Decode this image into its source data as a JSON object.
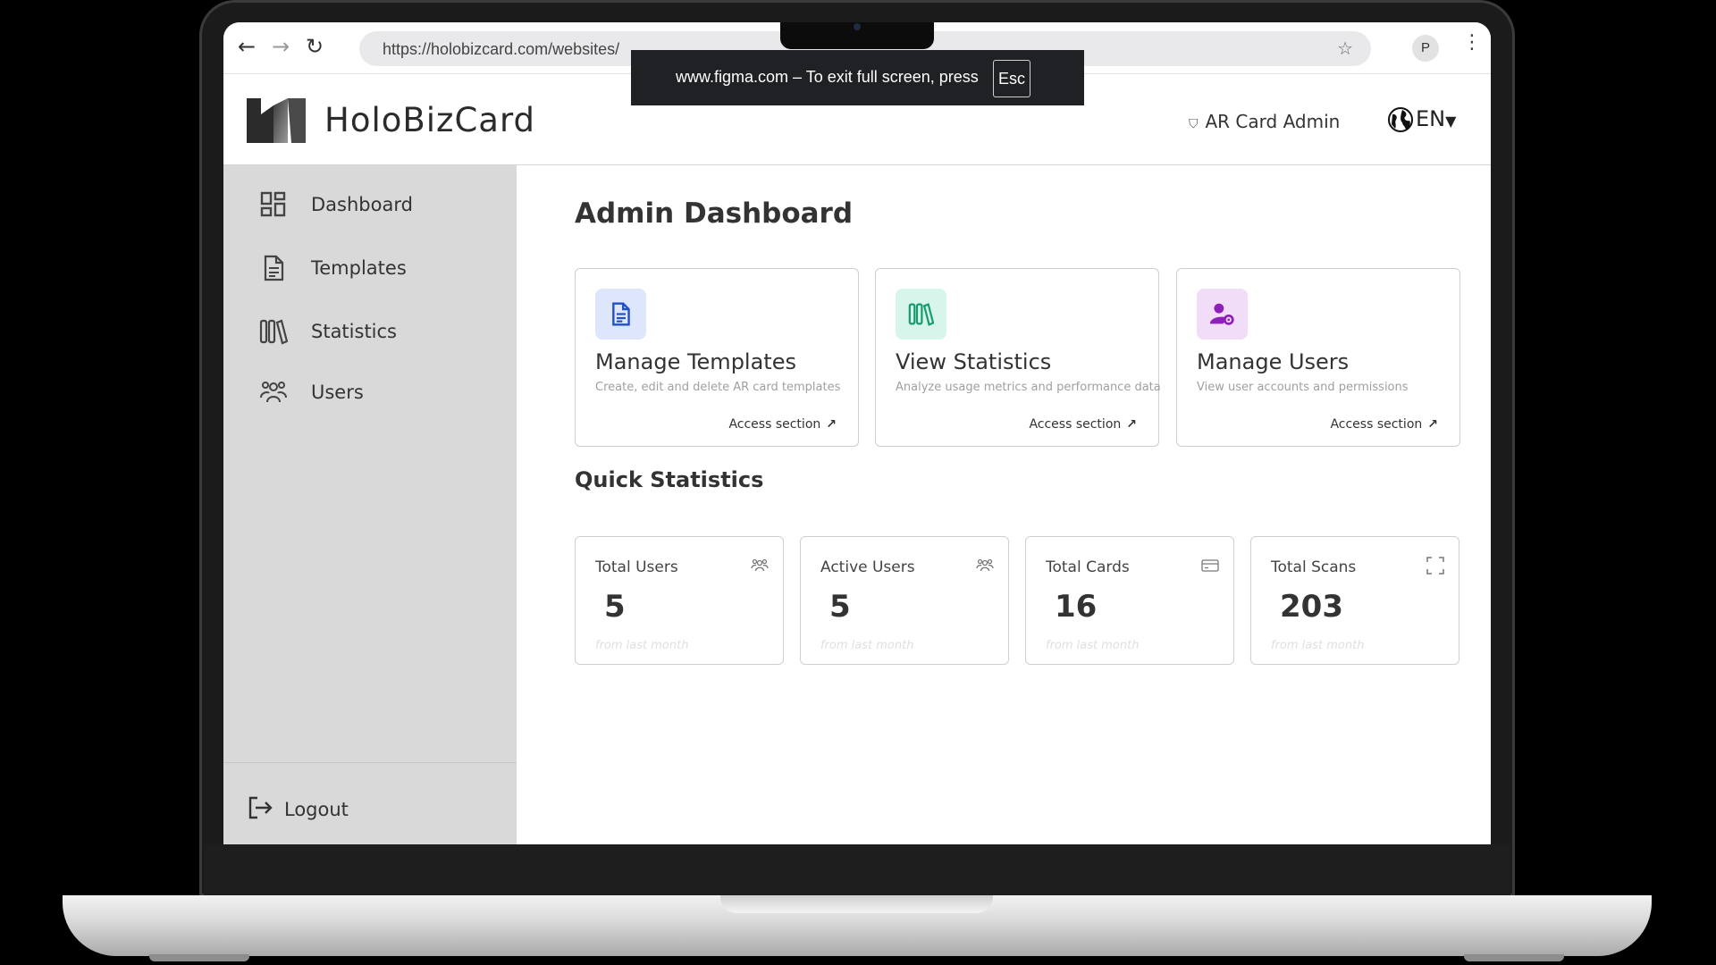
{
  "browser": {
    "url": "https://holobizcard.com/websites/",
    "profile_initial": "P",
    "fullscreen_message": "www.figma.com – To exit full screen, press",
    "fullscreen_key": "Esc"
  },
  "header": {
    "brand": "HoloBizCard",
    "admin_label": "AR Card Admin",
    "language": "EN"
  },
  "sidebar": {
    "items": [
      {
        "label": "Dashboard",
        "icon": "dashboard-icon"
      },
      {
        "label": "Templates",
        "icon": "document-icon"
      },
      {
        "label": "Statistics",
        "icon": "library-icon"
      },
      {
        "label": "Users",
        "icon": "users-icon"
      }
    ],
    "logout_label": "Logout"
  },
  "main": {
    "title": "Admin Dashboard",
    "cards": [
      {
        "title": "Manage Templates",
        "description": "Create, edit and delete AR card templates",
        "link": "Access section",
        "icon": "document-icon",
        "icon_bg": "#dde6fb",
        "icon_color": "#1f4fc9"
      },
      {
        "title": "View Statistics",
        "description": "Analyze usage metrics and performance data",
        "link": "Access section",
        "icon": "library-icon",
        "icon_bg": "#d7f5ea",
        "icon_color": "#169b6b"
      },
      {
        "title": "Manage Users",
        "description": "View user accounts and permissions",
        "link": "Access section",
        "icon": "user-gear-icon",
        "icon_bg": "#f1ddf7",
        "icon_color": "#8e1fb8"
      }
    ],
    "quick_title": "Quick Statistics",
    "stats": [
      {
        "label": "Total Users",
        "value": "5",
        "sub": "from last month",
        "icon": "users-icon"
      },
      {
        "label": "Active Users",
        "value": "5",
        "sub": "from last month",
        "icon": "users-icon"
      },
      {
        "label": "Total Cards",
        "value": "16",
        "sub": "from last month",
        "icon": "card-icon"
      },
      {
        "label": "Total Scans",
        "value": "203",
        "sub": "from last month",
        "icon": "scan-frame-icon"
      }
    ]
  }
}
